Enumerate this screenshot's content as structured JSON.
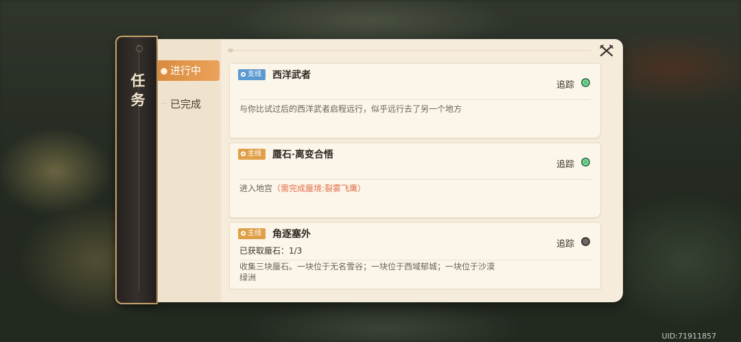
{
  "window": {
    "title": "任务"
  },
  "tabs": [
    {
      "label": "进行中",
      "active": true
    },
    {
      "label": "已完成",
      "active": false
    }
  ],
  "quests": [
    {
      "badge": "支线",
      "badge_color": "#5b9ad0",
      "title": "西洋武者",
      "subline": "",
      "track_label": "追踪",
      "tracked": true,
      "description": "与你比试过后的西洋武者启程远行，似乎远行去了另一个地方",
      "requirement": ""
    },
    {
      "badge": "主线",
      "badge_color": "#e0a04a",
      "title": "蜃石·离变合悟",
      "subline": "",
      "track_label": "追踪",
      "tracked": true,
      "description": "进入地宫",
      "requirement": "（需完成蜃境:裂雾飞鹰）"
    },
    {
      "badge": "主线",
      "badge_color": "#e0a04a",
      "title": "角逐塞外",
      "subline": "已获取蜃石：1/3",
      "track_label": "追踪",
      "tracked": false,
      "description": "收集三块蜃石。一块位于无名雪谷；一块位于西域郁城；一块位于沙漠绿洲",
      "requirement": ""
    }
  ],
  "footer": {
    "uid": "UID:71911857"
  },
  "icons": {
    "close": "close-x-icon",
    "tracked_on": "green-dot-icon",
    "tracked_off": "gray-dot-icon"
  }
}
